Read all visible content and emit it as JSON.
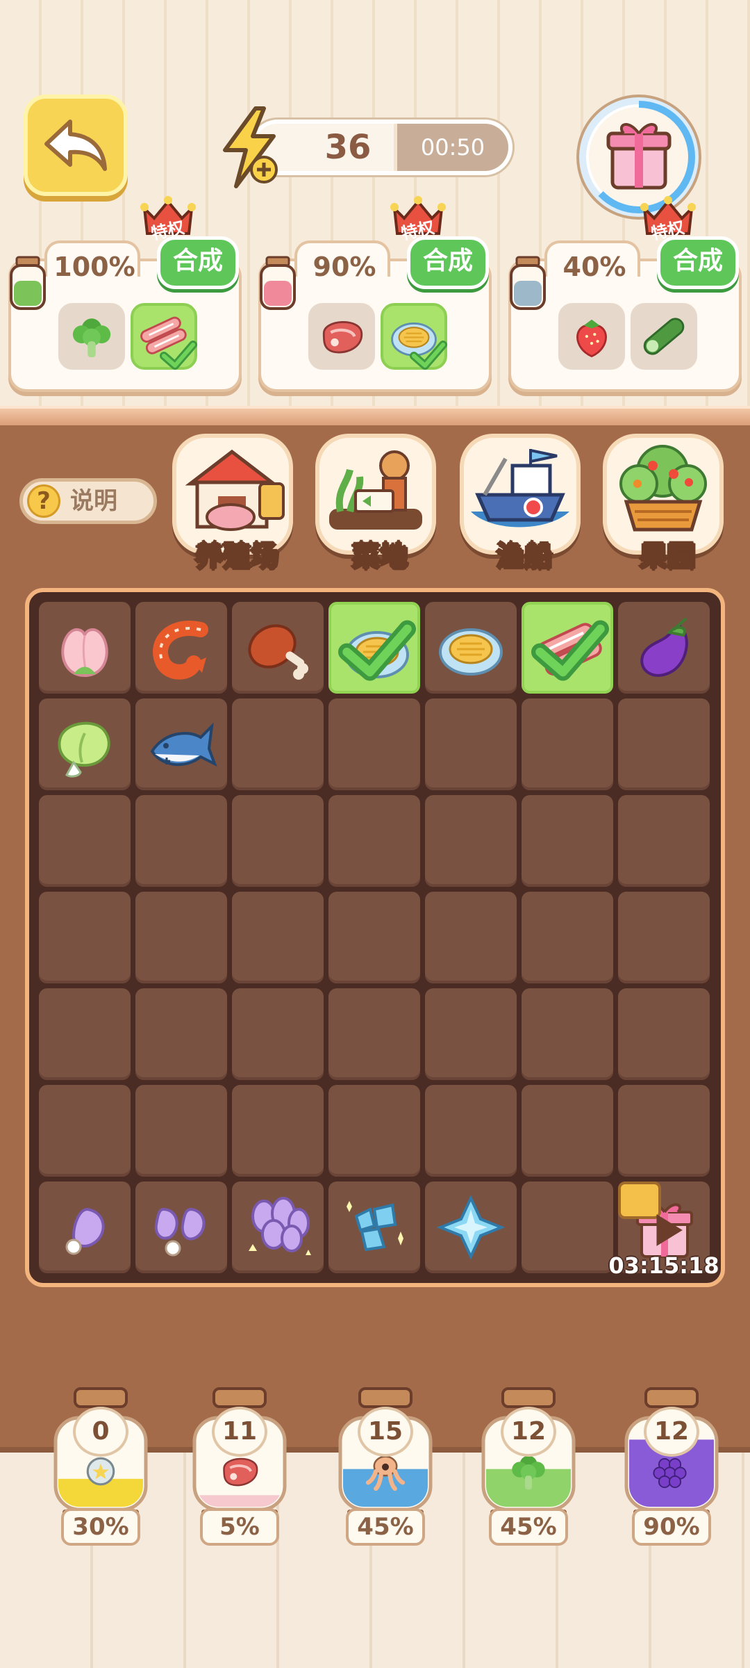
{
  "header": {
    "energy_value": "36",
    "energy_fill_fraction": 0.55,
    "energy_timer": "00:50"
  },
  "recipes": [
    {
      "percent": "100%",
      "combine": "合成",
      "privilege": "特权",
      "jar_color": "#7cc35a",
      "items": [
        {
          "icon": "broccoli-icon",
          "done": false
        },
        {
          "icon": "meat-roll-icon",
          "done": true
        }
      ]
    },
    {
      "percent": "90%",
      "combine": "合成",
      "privilege": "特权",
      "jar_color": "#f08a9a",
      "items": [
        {
          "icon": "steak-icon",
          "done": false
        },
        {
          "icon": "shell-icon",
          "done": true
        }
      ]
    },
    {
      "percent": "40%",
      "combine": "合成",
      "privilege": "特权",
      "jar_color": "#9db8c8",
      "items": [
        {
          "icon": "strawberry-icon",
          "done": false
        },
        {
          "icon": "cucumber-icon",
          "done": false
        }
      ]
    }
  ],
  "help_label": "说明",
  "categories": [
    "养殖场",
    "菜地",
    "渔船",
    "果园"
  ],
  "board": {
    "rows": [
      [
        "peach-icon",
        "shrimp-icon",
        "drumstick-icon",
        "shell-icon-done",
        "shell-icon",
        "meat-roll-icon-done",
        "eggplant-icon"
      ],
      [
        "cabbage-icon",
        "fish-icon",
        "",
        "",
        "",
        "",
        ""
      ],
      [
        "",
        "",
        "",
        "",
        "",
        "",
        ""
      ],
      [
        "",
        "",
        "",
        "",
        "",
        "",
        ""
      ],
      [
        "",
        "",
        "",
        "",
        "",
        "",
        ""
      ],
      [
        "",
        "",
        "",
        "",
        "",
        "",
        ""
      ],
      [
        "purple-seed-icon",
        "purple-seeds-icon",
        "purple-seed-bundle-icon",
        "crystal-cluster-icon",
        "crystal-icon",
        "",
        "gift-box-icon"
      ]
    ],
    "gift_timer": "03:15:18"
  },
  "jars": [
    {
      "count": "0",
      "percent": "30%",
      "fill": "#f4d83a",
      "icon": "coin-icon"
    },
    {
      "count": "11",
      "percent": "5%",
      "fill": "#f6c9cf",
      "icon": "steak-icon"
    },
    {
      "count": "15",
      "percent": "45%",
      "fill": "#5aa8e0",
      "icon": "octopus-icon"
    },
    {
      "count": "12",
      "percent": "45%",
      "fill": "#8fd36a",
      "icon": "broccoli-icon"
    },
    {
      "count": "12",
      "percent": "90%",
      "fill": "#8a5bd6",
      "icon": "grape-icon"
    }
  ]
}
